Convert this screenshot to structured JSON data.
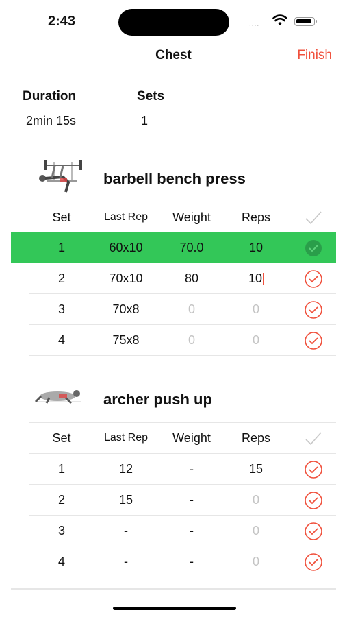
{
  "status": {
    "time": "2:43",
    "signal": "....",
    "icons": [
      "wifi-icon",
      "battery-icon"
    ]
  },
  "nav": {
    "title": "Chest",
    "finish_label": "Finish"
  },
  "summary": {
    "duration_label": "Duration",
    "duration_value": "2min 15s",
    "sets_label": "Sets",
    "sets_value": "1"
  },
  "columns": {
    "set": "Set",
    "last_rep": "Last Rep",
    "weight": "Weight",
    "reps": "Reps"
  },
  "colors": {
    "accent": "#f0503c",
    "done": "#33c758"
  },
  "exercises": [
    {
      "name": "barbell bench press",
      "sets": [
        {
          "set": "1",
          "last_rep": "60x10",
          "weight": "70.0",
          "reps": "10"
        },
        {
          "set": "2",
          "last_rep": "70x10",
          "weight": "80",
          "reps": "10"
        },
        {
          "set": "3",
          "last_rep": "70x8",
          "weight": "0",
          "reps": "0"
        },
        {
          "set": "4",
          "last_rep": "75x8",
          "weight": "0",
          "reps": "0"
        }
      ]
    },
    {
      "name": "archer push up",
      "sets": [
        {
          "set": "1",
          "last_rep": "12",
          "weight": "-",
          "reps": "15"
        },
        {
          "set": "2",
          "last_rep": "15",
          "weight": "-",
          "reps": "0"
        },
        {
          "set": "3",
          "last_rep": "-",
          "weight": "-",
          "reps": "0"
        },
        {
          "set": "4",
          "last_rep": "-",
          "weight": "-",
          "reps": "0"
        }
      ]
    }
  ]
}
